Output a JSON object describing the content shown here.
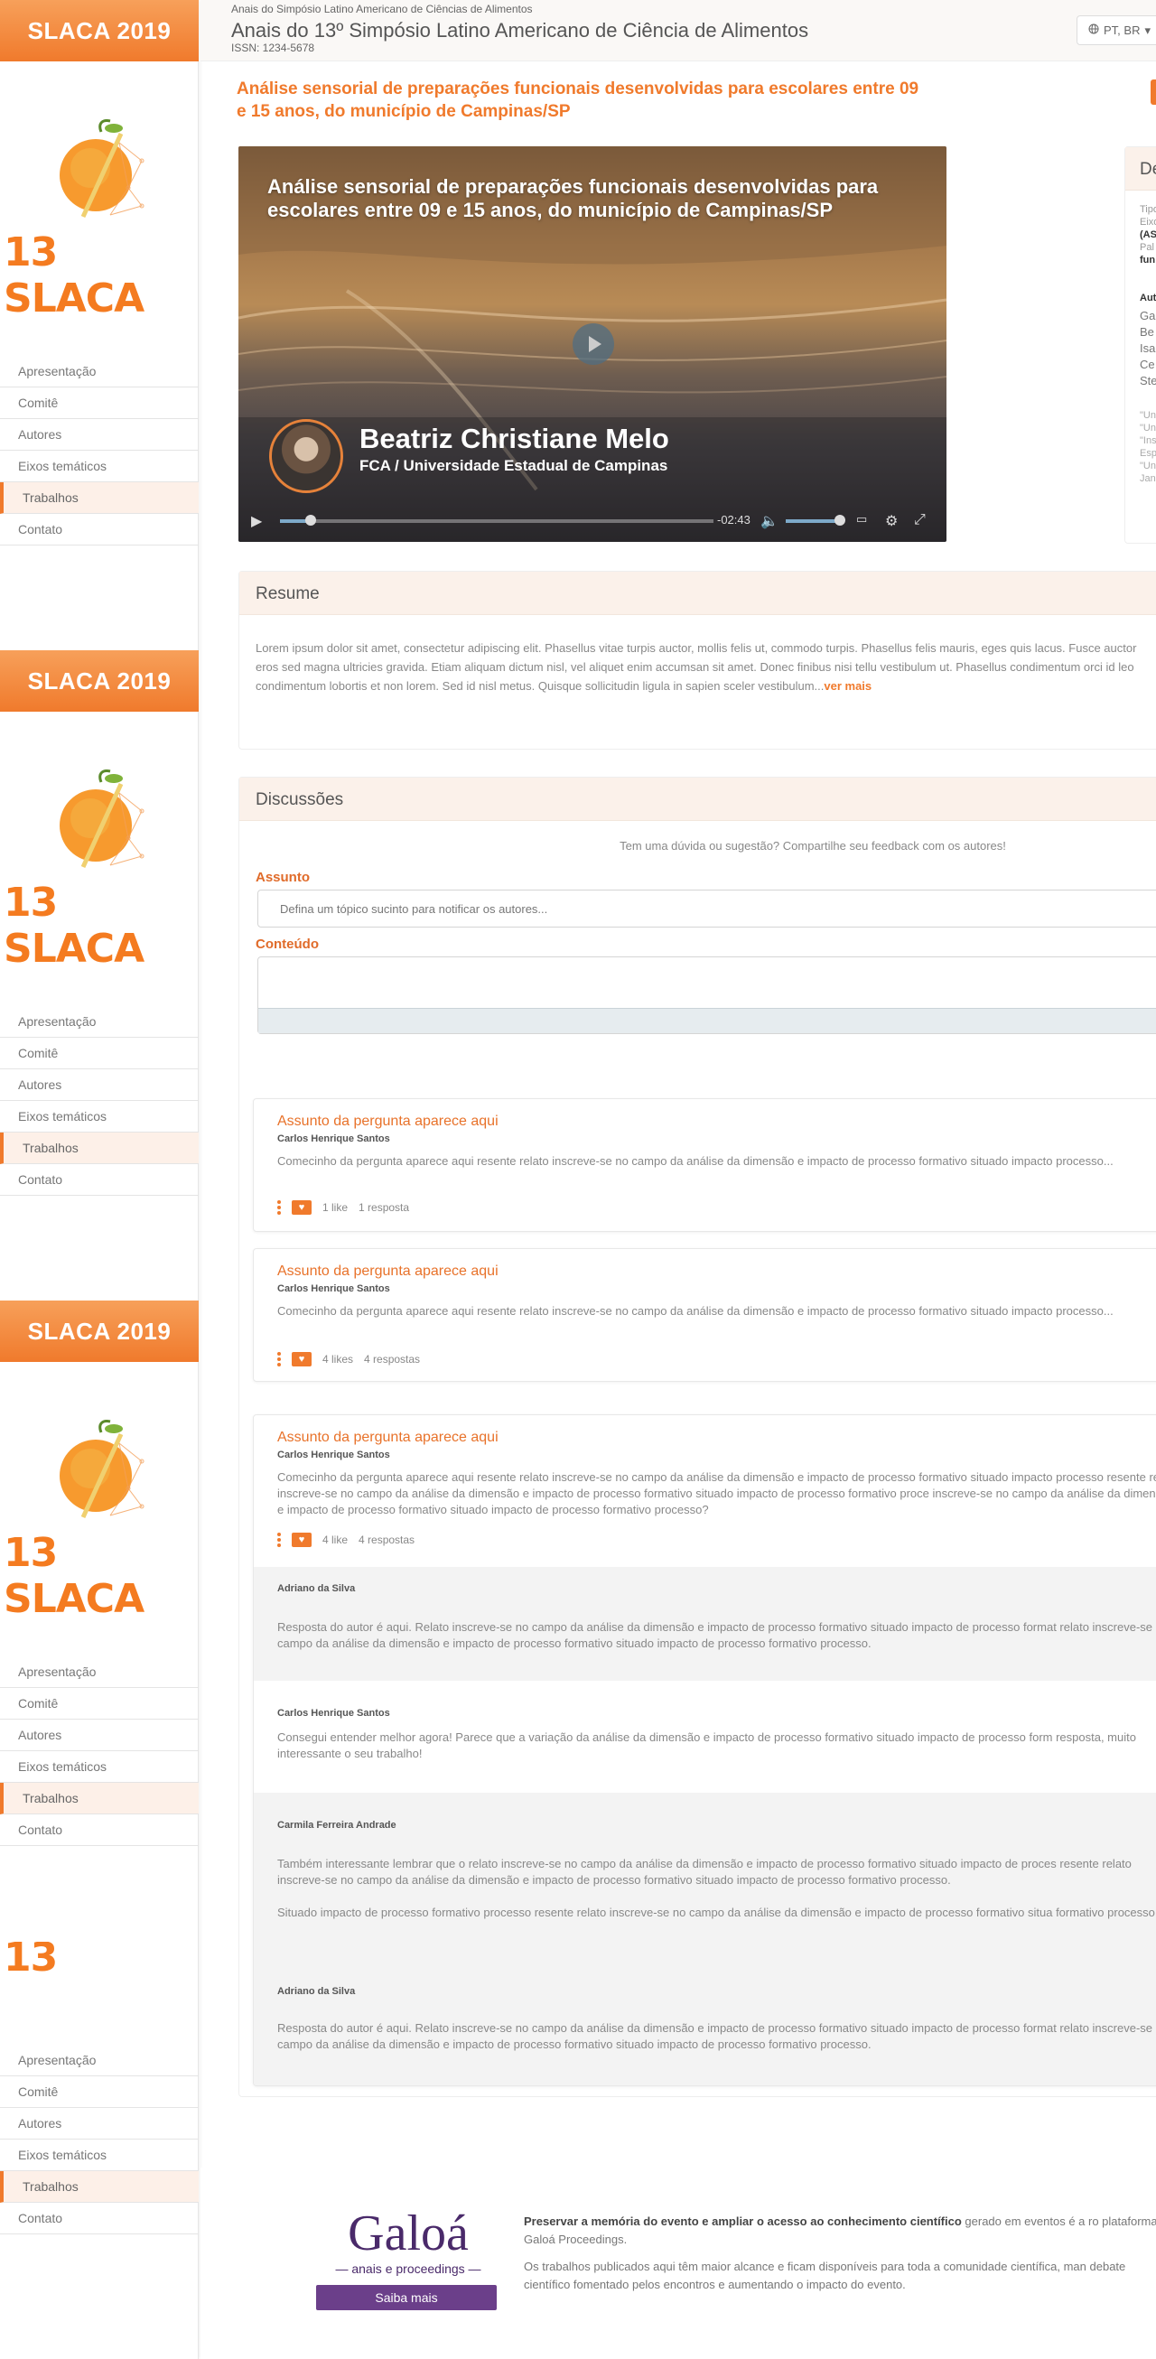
{
  "header": {
    "supertitle": "Anais do Simpósio Latino Americano de Ciências de Alimentos",
    "title": "Anais do 13º Simpósio Latino Americano de Ciência de Alimentos",
    "issn": "ISSN: 1234-5678",
    "language": "PT, BR"
  },
  "sidebar": {
    "banner": "SLACA 2019",
    "logo_text": "13 SLACA",
    "items": [
      "Apresentação",
      "Comitê",
      "Autores",
      "Eixos temáticos",
      "Trabalhos",
      "Contato"
    ],
    "active_item": "Trabalhos"
  },
  "paper": {
    "title": "Análise sensorial de preparações funcionais desenvolvidas para escolares entre 09 e 15 anos, do município de Campinas/SP"
  },
  "video": {
    "title": "Análise sensorial de preparações funcionais desenvolvidas para escolares entre 09 e 15 anos, do município de Campinas/SP",
    "presenter": "Beatriz Christiane Melo",
    "affiliation": "FCA / Universidade Estadual de Campinas",
    "time_remaining": "-02:43",
    "progress": 0.07,
    "volume": 1.0
  },
  "details": {
    "heading": "De",
    "lines": [
      "Tipo",
      "Eixo",
      "(AS",
      "Pal",
      "fun"
    ],
    "authors_heading": "Aut",
    "authors": [
      "Ga",
      "Be",
      "Isa",
      "Ce",
      "Ste"
    ],
    "affiliations": [
      "\"Un",
      "\"Un",
      "\"Ins",
      "Esp",
      "\"Un",
      "Jan"
    ]
  },
  "resume": {
    "heading": "Resume",
    "text": "Lorem ipsum dolor sit amet, consectetur adipiscing elit. Phasellus vitae turpis auctor, mollis felis ut, commodo turpis. Phasellus felis mauris, eges quis lacus. Fusce auctor eros sed magna ultricies gravida. Etiam aliquam dictum nisl, vel aliquet enim accumsan sit amet. Donec finibus nisi tellu vestibulum ut. Phasellus condimentum orci id leo condimentum lobortis et non lorem. Sed id nisl metus. Quisque sollicitudin ligula in sapien sceler vestibulum...",
    "more": "ver mais"
  },
  "discussions": {
    "heading": "Discussões",
    "intro": "Tem uma dúvida ou sugestão? Compartilhe seu feedback com os autores!",
    "subject_label": "Assunto",
    "subject_placeholder": "Defina um tópico sucinto para notificar os autores...",
    "content_label": "Conteúdo"
  },
  "questions": [
    {
      "title": "Assunto da pergunta aparece aqui",
      "author": "Carlos Henrique Santos",
      "text": "Comecinho da pergunta aparece aqui resente relato inscreve-se no campo da análise da dimensão e impacto de processo formativo situado impacto processo...",
      "likes": "1 like",
      "replies": "1 resposta"
    },
    {
      "title": "Assunto da pergunta aparece aqui",
      "author": "Carlos Henrique Santos",
      "text": "Comecinho da pergunta aparece aqui resente relato inscreve-se no campo da análise da dimensão e impacto de processo formativo situado impacto processo...",
      "likes": "4 likes",
      "replies": "4 respostas"
    },
    {
      "title": "Assunto da pergunta aparece aqui",
      "author": "Carlos Henrique Santos",
      "text": "Comecinho da pergunta aparece aqui resente relato inscreve-se no campo da análise da dimensão e impacto de processo formativo situado impacto processo resente relato inscreve-se no campo da análise da dimensão e impacto de processo formativo situado impacto de processo formativo proce inscreve-se no campo da análise da dimensão e impacto de processo formativo situado impacto de processo formativo processo?",
      "likes": "4 like",
      "replies": "4 respostas"
    }
  ],
  "replies": [
    {
      "author": "Adriano da Silva",
      "text": "Resposta do autor é aqui. Relato inscreve-se no campo da análise da dimensão e impacto de processo formativo situado impacto de processo format relato inscreve-se no campo da análise da dimensão e impacto de processo formativo situado impacto de processo formativo processo."
    },
    {
      "author": "Carlos Henrique Santos",
      "text": "Consegui entender melhor agora! Parece que a variação da análise da dimensão e impacto de processo formativo situado impacto de processo form resposta, muito interessante o seu trabalho!"
    },
    {
      "author": "Carmila Ferreira Andrade",
      "text": "Também interessante lembrar que o relato inscreve-se no campo da análise da dimensão e impacto de processo formativo situado impacto de proces resente relato inscreve-se no campo da análise da dimensão e impacto de processo formativo situado impacto de processo formativo processo.",
      "text2": "Situado impacto de processo formativo processo resente relato inscreve-se no campo da análise da dimensão e impacto de processo formativo situa formativo processo."
    },
    {
      "author": "Adriano da Silva",
      "text": "Resposta do autor é aqui. Relato inscreve-se no campo da análise da dimensão e impacto de processo formativo situado impacto de processo format relato inscreve-se no campo da análise da dimensão e impacto de processo formativo situado impacto de processo formativo processo."
    }
  ],
  "footer": {
    "logo": "Galoá",
    "logo_sub": "— anais e proceedings —",
    "button": "Saiba mais",
    "p1_bold": "Preservar a memória do evento e ampliar o acesso ao conhecimento científico",
    "p1_rest": " gerado em eventos é a ro plataforma Galoá Proceedings.",
    "p2": "Os trabalhos publicados aqui têm maior alcance e ficam disponíveis para toda a comunidade científica, man debate científico fomentado pelos encontros e aumentando o impacto do evento."
  },
  "colors": {
    "accent": "#f07a2c",
    "galoa_purple": "#6b3f8a",
    "panel_header": "#fbf1ea"
  }
}
